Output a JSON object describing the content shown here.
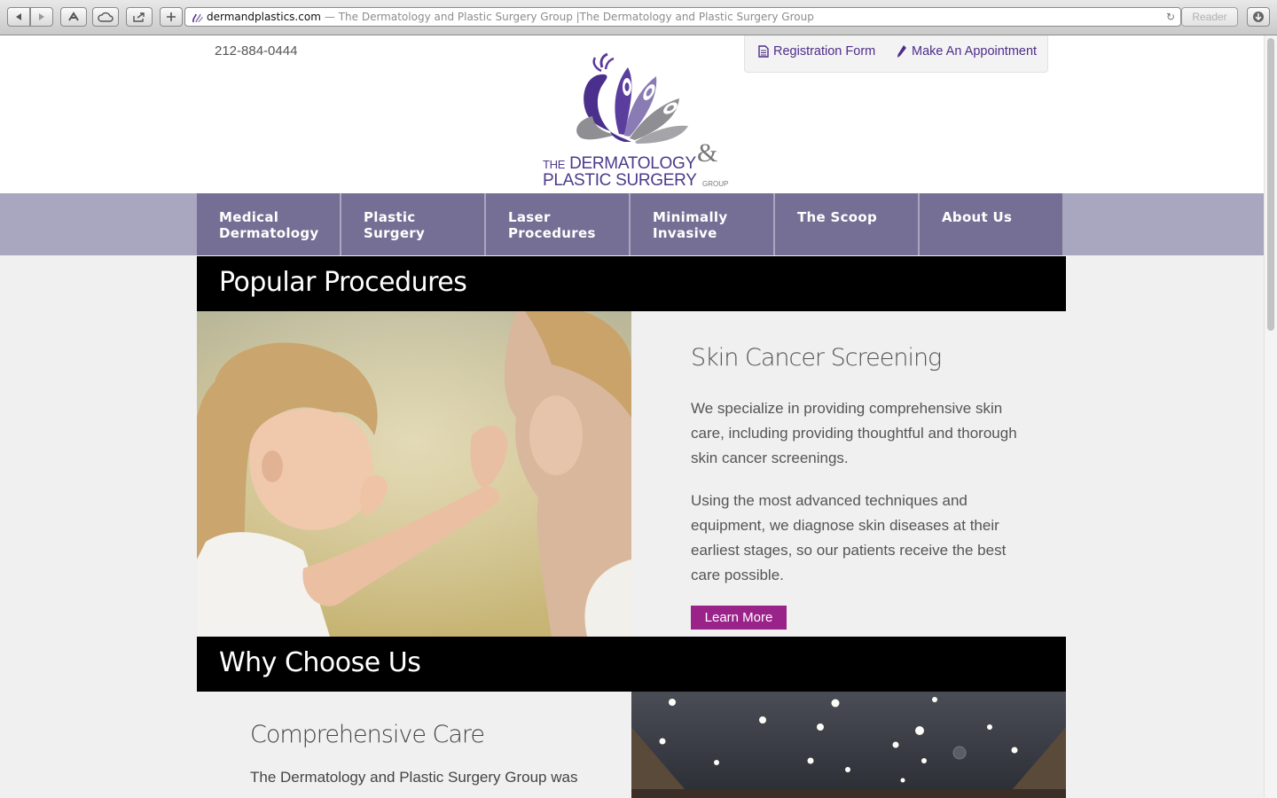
{
  "browser": {
    "url_domain": "dermandplastics.com",
    "url_title": "— The Dermatology and Plastic Surgery Group |The Dermatology and Plastic Surgery Group",
    "reader_label": "Reader"
  },
  "header": {
    "phone": "212-884-0444",
    "registration_label": "Registration Form",
    "appointment_label": "Make An Appointment",
    "logo": {
      "the": "THE",
      "line1": "DERMATOLOGY",
      "line2": "PLASTIC SURGERY",
      "amp": "&",
      "group": "GROUP"
    }
  },
  "nav": [
    {
      "label": "Medical\nDermatology"
    },
    {
      "label": "Plastic\nSurgery"
    },
    {
      "label": "Laser\nProcedures"
    },
    {
      "label": "Minimally\nInvasive"
    },
    {
      "label": "The Scoop"
    },
    {
      "label": "About Us"
    }
  ],
  "popular": {
    "heading": "Popular Procedures",
    "title": "Skin Cancer Screening",
    "para1": "We specialize in providing comprehensive skin care, including providing thoughtful and thorough skin cancer screenings.",
    "para2": "Using the most advanced techniques and equipment, we diagnose skin diseases at their earliest stages, so our patients receive the best care possible.",
    "button": "Learn More"
  },
  "why": {
    "heading": "Why Choose Us",
    "title": "Comprehensive Care",
    "para": "The Dermatology and Plastic Surgery Group was"
  },
  "colors": {
    "nav_bg": "#766f95",
    "nav_band": "#a9a6bf",
    "brand_purple": "#4e2c8a",
    "button": "#9a238a"
  }
}
